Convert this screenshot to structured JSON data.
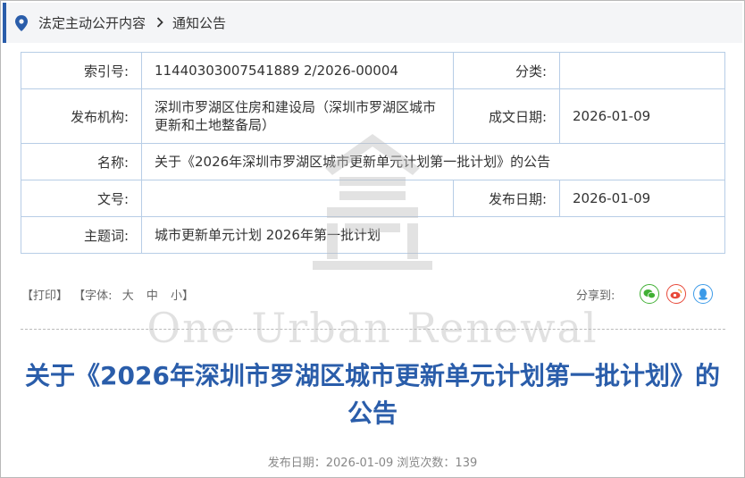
{
  "breadcrumb": {
    "item1": "法定主动公开内容",
    "item2": "通知公告"
  },
  "meta_table": {
    "index_label": "索引号:",
    "index_value": "11440303007541889 2/2026-00004",
    "category_label": "分类:",
    "category_value": "",
    "publisher_label": "发布机构:",
    "publisher_value": "深圳市罗湖区住房和建设局（深圳市罗湖区城市更新和土地整备局）",
    "written_date_label": "成文日期:",
    "written_date_value": "2026-01-09",
    "name_label": "名称:",
    "name_value": "关于《2026年深圳市罗湖区城市更新单元计划第一批计划》的公告",
    "doc_no_label": "文号:",
    "doc_no_value": "",
    "publish_date_label": "发布日期:",
    "publish_date_value": "2026-01-09",
    "keywords_label": "主题词:",
    "keywords_value": "城市更新单元计划 2026年第一批计划"
  },
  "watermark": {
    "text": "One Urban Renewal"
  },
  "toolbar": {
    "print": "【打印】",
    "font_label": "【字体:",
    "font_large": "大",
    "font_medium": "中",
    "font_small": "小】",
    "share_label": "分享到:"
  },
  "article": {
    "title": "关于《2026年深圳市罗湖区城市更新单元计划第一批计划》的公告",
    "publish_info": "发布日期：2026-01-09  浏览次数：139"
  },
  "colors": {
    "accent": "#2a5daa",
    "table_border": "#b7cde6",
    "wechat": "#41b035",
    "weibo": "#e8493a",
    "qq": "#3d9be8"
  }
}
